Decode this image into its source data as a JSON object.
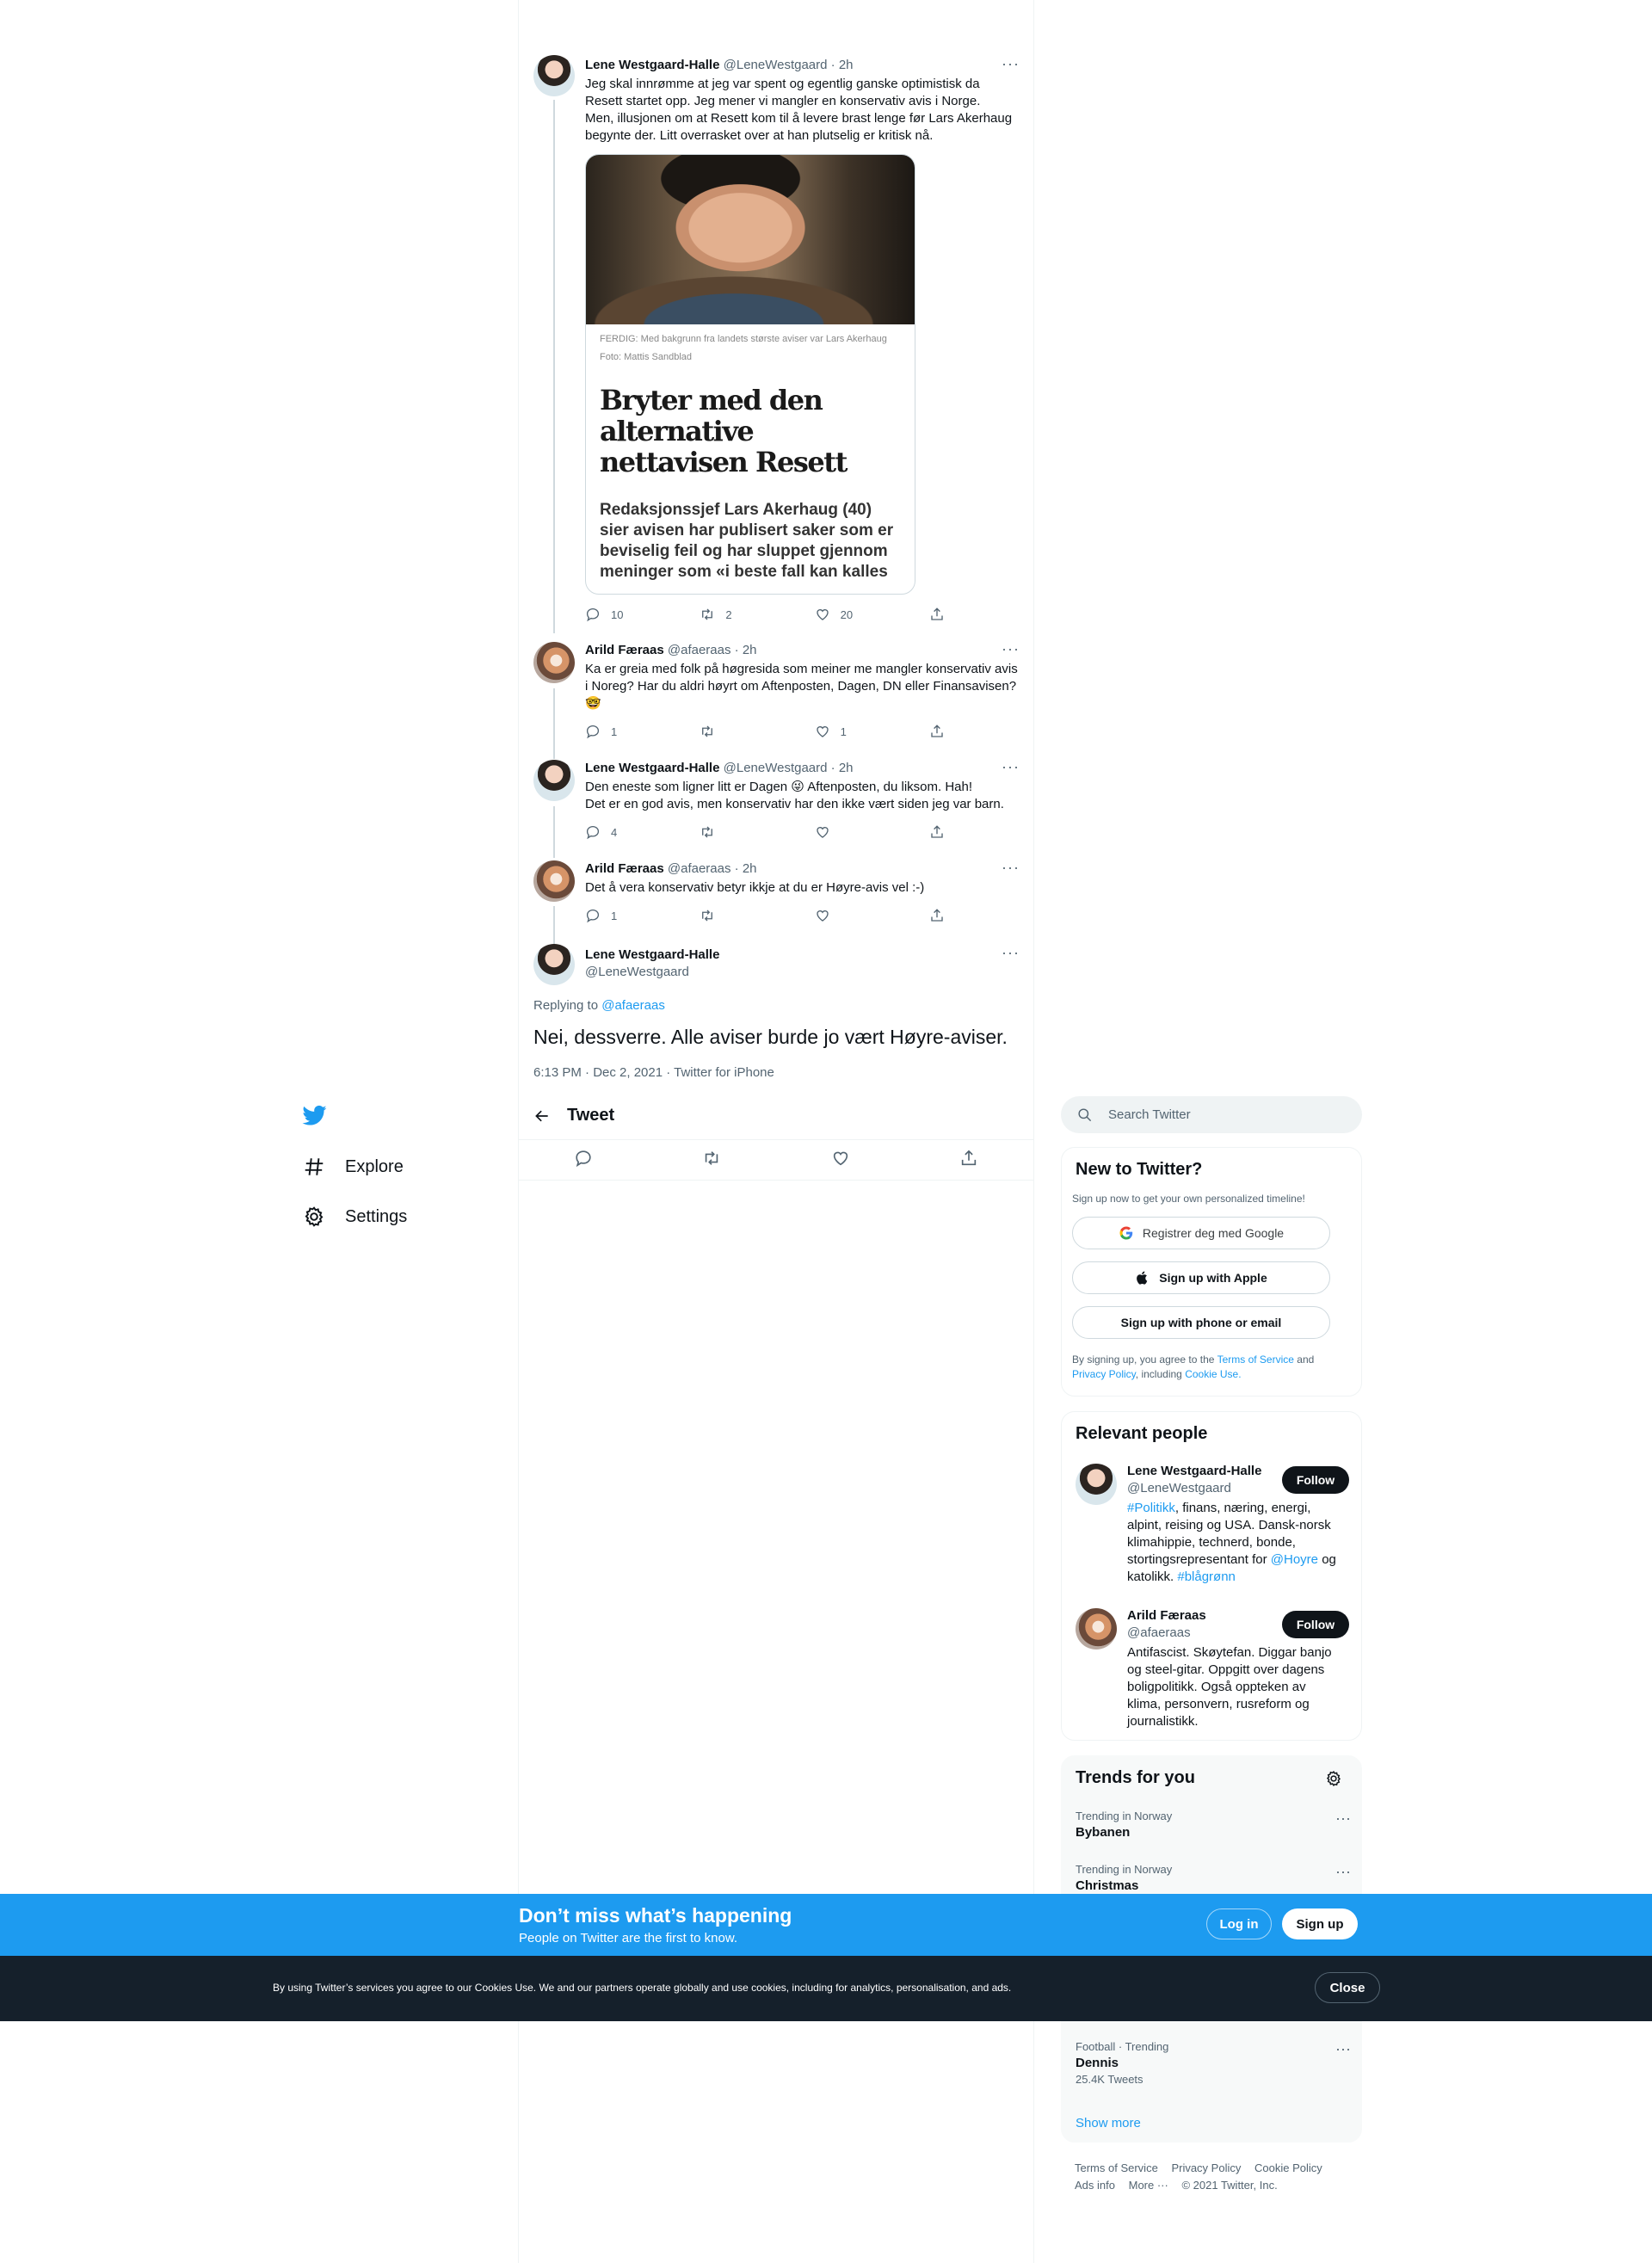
{
  "nav": {
    "items": [
      {
        "label": "Explore",
        "icon": "hashtag-icon"
      },
      {
        "label": "Settings",
        "icon": "gear-icon"
      }
    ]
  },
  "header": {
    "title": "Tweet"
  },
  "thread": [
    {
      "name": "Lene Westgaard-Halle",
      "handle": "@LeneWestgaard",
      "time": "· 2h",
      "text": "Jeg skal innrømme at jeg var spent og egentlig ganske optimistisk da Resett startet opp. Jeg mener vi mangler en konservativ avis i Norge.\nMen, illusjonen om at Resett kom til å levere brast lenge før Lars Akerhaug begynte der. Litt overrasket over at han plutselig er kritisk nå.",
      "replies": "10",
      "retweets": "2",
      "likes": "20"
    },
    {
      "name": "Arild Færaas",
      "handle": "@afaeraas",
      "time": "· 2h",
      "text": "Ka er greia med folk på høgresida som meiner me mangler konservativ avis i Noreg? Har du aldri høyrt om Aftenposten, Dagen, DN eller Finansavisen?\n🤓",
      "replies": "1",
      "retweets": "",
      "likes": "1"
    },
    {
      "name": "Lene Westgaard-Halle",
      "handle": "@LeneWestgaard",
      "time": "· 2h",
      "text": "Den eneste som ligner litt er Dagen 😜 Aftenposten, du liksom. Hah!\nDet er en god avis, men konservativ har den ikke vært siden jeg var barn.",
      "replies": "4",
      "retweets": "",
      "likes": ""
    },
    {
      "name": "Arild Færaas",
      "handle": "@afaeraas",
      "time": "· 2h",
      "text": "Det å vera konservativ betyr ikkje at du er Høyre-avis vel :-)",
      "replies": "1",
      "retweets": "",
      "likes": ""
    }
  ],
  "media": {
    "caption": "FERDIG: Med bakgrunn fra landets største aviser var Lars Akerhaug",
    "credit": "Foto: Mattis Sandblad",
    "headline": "Bryter med den alternative nettavisen Resett",
    "lead": "Redaksjonssjef Lars Akerhaug (40) sier avisen har publisert saker som er beviselig feil og har sluppet gjennom meninger som «i beste fall kan kalles"
  },
  "focus": {
    "name": "Lene Westgaard-Halle",
    "handle": "@LeneWestgaard",
    "replying_prefix": "Replying to",
    "replying_to": "@afaeraas",
    "text": "Nei, dessverre. Alle aviser burde jo vært Høyre-aviser.",
    "meta": "6:13 PM · Dec 2, 2021 · Twitter for iPhone"
  },
  "search": {
    "placeholder": "Search Twitter"
  },
  "new_to_twitter": {
    "title": "New to Twitter?",
    "subtitle": "Sign up now to get your own personalized timeline!",
    "google": "Registrer deg med Google",
    "apple": "Sign up with Apple",
    "phone": "Sign up with phone or email",
    "terms_1": "By signing up, you agree to the",
    "terms_link1": "Terms of Service",
    "terms_2": "and",
    "terms_link2": "Privacy Policy",
    "terms_3": ", including",
    "terms_link3": "Cookie Use."
  },
  "relevant": {
    "title": "Relevant people",
    "follow": "Follow",
    "people": [
      {
        "name": "Lene Westgaard-Halle",
        "handle": "@LeneWestgaard",
        "bio_link1": "#Politikk",
        "bio_1": ", finans, næring, energi, alpint, reising og USA. Dansk-norsk klimahippie, technerd, bonde, stortingsrepresentant for",
        "bio_link2": "@Hoyre",
        "bio_2": "og katolikk.",
        "bio_link3": "#blågrønn"
      },
      {
        "name": "Arild Færaas",
        "handle": "@afaeraas",
        "bio": "Antifascist. Skøytefan. Diggar banjo og steel-gitar. Oppgitt over dagens boligpolitikk. Også oppteken av klima, personvern, rusreform og journalistikk."
      }
    ]
  },
  "trends": {
    "title": "Trends for you",
    "items": [
      {
        "context": "Trending in Norway",
        "name": "Bybanen",
        "count": ""
      },
      {
        "context": "Trending in Norway",
        "name": "Christmas",
        "count": ""
      },
      {
        "context": "Football · Trending",
        "name": "Dennis",
        "count": "25.4K Tweets"
      }
    ],
    "show_more": "Show more"
  },
  "footer": {
    "row1": [
      "Terms of Service",
      "Privacy Policy",
      "Cookie Policy"
    ],
    "row2": [
      "Ads info",
      "More ···",
      "© 2021 Twitter, Inc."
    ]
  },
  "banner": {
    "title": "Don’t miss what’s happening",
    "subtitle": "People on Twitter are the first to know.",
    "login": "Log in",
    "signup": "Sign up"
  },
  "cookie": {
    "text": "By using Twitter’s services you agree to our Cookies Use. We and our partners operate globally and use cookies, including for analytics, personalisation, and ads.",
    "close": "Close"
  },
  "colors": {
    "accent": "#1d9bf0",
    "text": "#0f1419",
    "muted": "#536471",
    "dark_banner": "#15202b"
  }
}
